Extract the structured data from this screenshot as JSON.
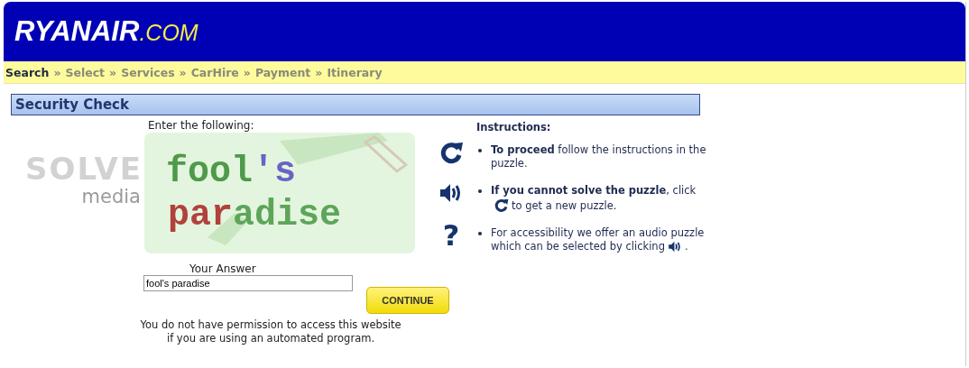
{
  "logo": {
    "brand": "RYANAIR",
    "suffix": ".COM"
  },
  "breadcrumb": {
    "separator": "»",
    "steps": [
      {
        "label": "Search",
        "selected": true
      },
      {
        "label": "Select",
        "selected": false
      },
      {
        "label": "Services",
        "selected": false
      },
      {
        "label": "CarHire",
        "selected": false
      },
      {
        "label": "Payment",
        "selected": false
      },
      {
        "label": "Itinerary",
        "selected": false
      }
    ]
  },
  "section_title": "Security Check",
  "provider": {
    "name": "SOLVE",
    "sub": "media"
  },
  "captcha": {
    "prompt": "Enter the following:",
    "lines": [
      [
        {
          "text": "fool",
          "color": "#4f9a4a"
        },
        {
          "text": "'s",
          "color": "#6a62c4"
        }
      ],
      [
        {
          "text": "par",
          "color": "#b2413c"
        },
        {
          "text": "adise",
          "color": "#5ea55a"
        }
      ]
    ]
  },
  "tools": [
    {
      "kind": "refresh"
    },
    {
      "kind": "audio"
    },
    {
      "kind": "help",
      "text": "?"
    }
  ],
  "answer": {
    "label": "Your Answer",
    "value": "fool's paradise"
  },
  "continue_button": "CONTINUE",
  "notice": [
    "You do not have permission to access this website",
    "if you are using an automated program."
  ],
  "instructions": {
    "title": "Instructions:",
    "items": [
      {
        "rows": [
          [
            {
              "kind": "text",
              "text": "**To proceed** follow the instructions in the"
            }
          ],
          [
            {
              "kind": "text",
              "text": "puzzle."
            }
          ]
        ]
      },
      {
        "rows": [
          [
            {
              "kind": "text",
              "text": "**If you cannot solve the puzzle**, click"
            }
          ],
          [
            {
              "kind": "refresh"
            },
            {
              "kind": "text",
              "text": "to get a new puzzle."
            }
          ]
        ]
      },
      {
        "rows": [
          [
            {
              "kind": "text",
              "text": "For accessibility we offer an audio puzzle"
            }
          ],
          [
            {
              "kind": "text",
              "text": "which can be selected by clicking"
            },
            {
              "kind": "audio"
            },
            {
              "kind": "text",
              "text": "."
            }
          ]
        ]
      }
    ]
  }
}
